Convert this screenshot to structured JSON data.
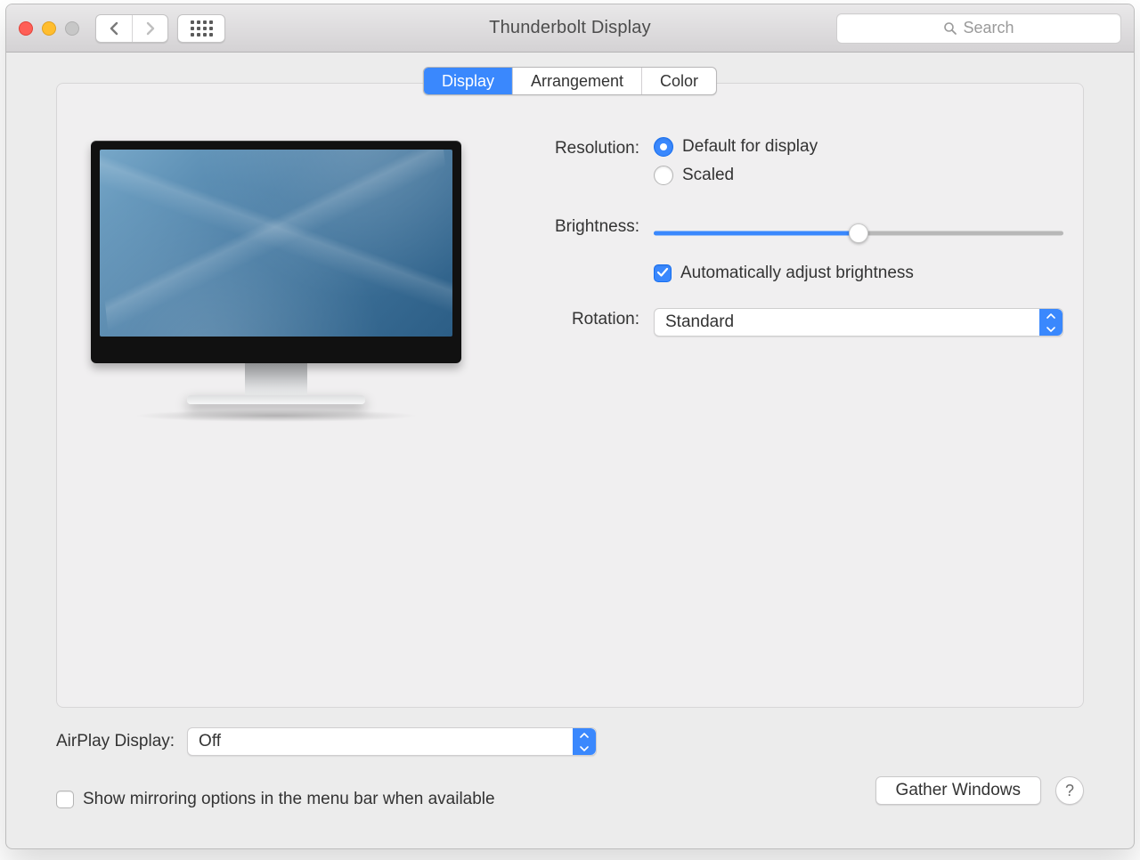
{
  "window": {
    "title": "Thunderbolt Display"
  },
  "toolbar": {
    "search_placeholder": "Search"
  },
  "tabs": {
    "display": "Display",
    "arrangement": "Arrangement",
    "color": "Color",
    "active": "Display"
  },
  "settings": {
    "resolution": {
      "label": "Resolution:",
      "options": {
        "default": "Default for display",
        "scaled": "Scaled"
      },
      "selected": "default"
    },
    "brightness": {
      "label": "Brightness:",
      "value_percent": 50,
      "auto_label": "Automatically adjust brightness",
      "auto_checked": true
    },
    "rotation": {
      "label": "Rotation:",
      "value": "Standard"
    }
  },
  "airplay": {
    "label": "AirPlay Display:",
    "value": "Off"
  },
  "mirroring": {
    "label": "Show mirroring options in the menu bar when available",
    "checked": false
  },
  "buttons": {
    "gather": "Gather Windows"
  }
}
